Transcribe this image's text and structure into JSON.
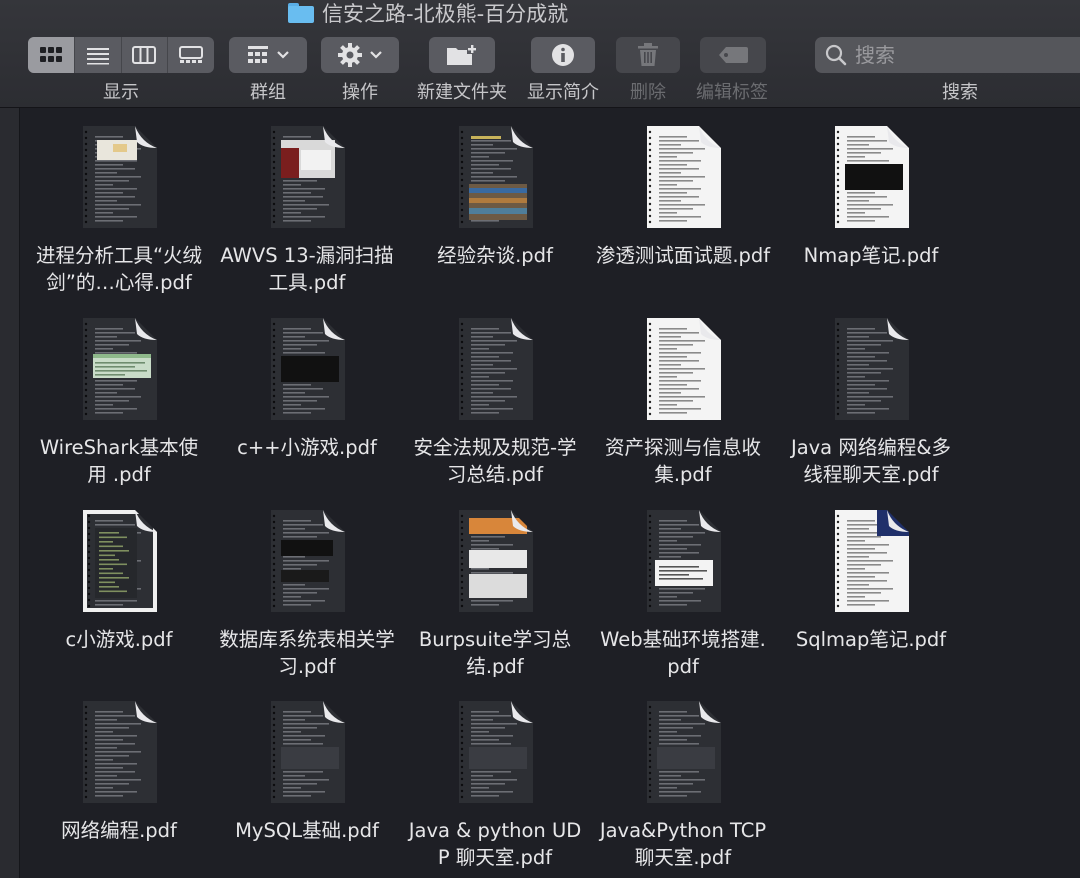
{
  "window": {
    "title": "信安之路-北极熊-百分成就"
  },
  "toolbar": {
    "view_label": "显示",
    "group_label": "群组",
    "action_label": "操作",
    "new_folder_label": "新建文件夹",
    "info_label": "显示简介",
    "delete_label": "删除",
    "tag_label": "编辑标签",
    "search_label": "搜索",
    "search_placeholder": "搜索"
  },
  "files": [
    {
      "name": "进程分析工具“火绒剑”的…心得.pdf",
      "theme": "dark",
      "img": "screenshot-light"
    },
    {
      "name": "AWVS 13-漏洞扫描工具.pdf",
      "theme": "dark",
      "img": "dialog-red"
    },
    {
      "name": "经验杂谈.pdf",
      "theme": "dark",
      "img": "photo-strip"
    },
    {
      "name": "渗透测试面试题.pdf",
      "theme": "light",
      "img": "none"
    },
    {
      "name": "Nmap笔记.pdf",
      "theme": "light",
      "img": "terminal"
    },
    {
      "name": "WireShark基本使用 .pdf",
      "theme": "dark",
      "img": "table-green"
    },
    {
      "name": "c++小游戏.pdf",
      "theme": "dark",
      "img": "terminal"
    },
    {
      "name": "安全法规及规范-学习总结.pdf",
      "theme": "dark",
      "img": "none"
    },
    {
      "name": "资产探测与信息收集.pdf",
      "theme": "light",
      "img": "none"
    },
    {
      "name": "Java 网络编程&多线程聊天室.pdf",
      "theme": "dark",
      "img": "none"
    },
    {
      "name": "c小游戏.pdf",
      "theme": "darkbordered",
      "img": "code"
    },
    {
      "name": "数据库系统表相关学习.pdf",
      "theme": "dark",
      "img": "terminal-small"
    },
    {
      "name": "Burpsuite学习总结.pdf",
      "theme": "dark",
      "img": "orange-banner"
    },
    {
      "name": "Web基础环境搭建.pdf",
      "theme": "dark",
      "img": "white-panel"
    },
    {
      "name": "Sqlmap笔记.pdf",
      "theme": "light",
      "img": "blue-corner"
    },
    {
      "name": "网络编程.pdf",
      "theme": "dark",
      "img": "none"
    },
    {
      "name": "MySQL基础.pdf",
      "theme": "dark",
      "img": "code-block"
    },
    {
      "name": "Java & python UDP 聊天室.pdf",
      "theme": "dark",
      "img": "code-block"
    },
    {
      "name": "Java&Python TCP 聊天室.pdf",
      "theme": "dark",
      "img": "code-block"
    }
  ]
}
